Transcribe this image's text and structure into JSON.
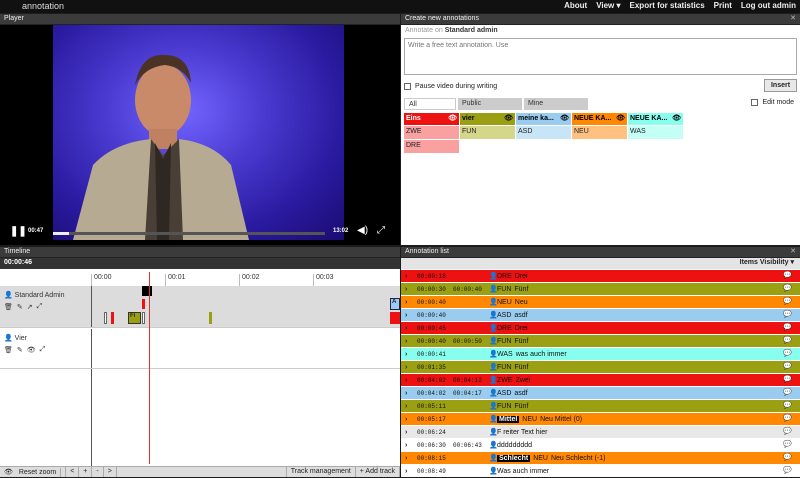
{
  "topbar": {
    "brand": "annotation",
    "menu": [
      "About",
      "View ▾",
      "Export for statistics",
      "Print",
      "Log out admin"
    ]
  },
  "player": {
    "header": "Player",
    "current_time": "00:47",
    "duration": "13:02",
    "progress": 0.06
  },
  "create": {
    "header": "Create new annotations",
    "annotate_on_label": "Annotate on",
    "annotate_on_value": "Standard admin",
    "placeholder": "Write a free text annotation. Use",
    "pause_label": "Pause video during writing",
    "insert_label": "Insert",
    "tabs": [
      "All",
      "Public",
      "Mine"
    ],
    "edit_mode_label": "Edit mode",
    "categories": [
      {
        "name": "Eins",
        "color": "#ee1111",
        "text": "#ffffff",
        "labels": [
          {
            "t": "ZWE",
            "c": "#f9a0a0"
          },
          {
            "t": "DRE",
            "c": "#f9a0a0"
          }
        ]
      },
      {
        "name": "vier",
        "color": "#9aa011",
        "text": "#000000",
        "labels": [
          {
            "t": "FUN",
            "c": "#d4d68a"
          }
        ]
      },
      {
        "name": "meine ka...",
        "color": "#99ccee",
        "text": "#000000",
        "labels": [
          {
            "t": "ASD",
            "c": "#c8e4f7"
          }
        ]
      },
      {
        "name": "NEUE KA...",
        "color": "#ff8800",
        "text": "#000000",
        "labels": [
          {
            "t": "NEU",
            "c": "#ffc080"
          }
        ]
      },
      {
        "name": "NEUE KA...",
        "color": "#88ffee",
        "text": "#000000",
        "labels": [
          {
            "t": "WAS",
            "c": "#c4fff6"
          }
        ]
      }
    ]
  },
  "timeline": {
    "header": "Timeline",
    "current": "00:00:46",
    "ticks": [
      "00:00",
      "00:01",
      "00:02",
      "00:03"
    ],
    "tracks": [
      {
        "name": "Standard Admin"
      },
      {
        "name": "Vier"
      }
    ],
    "marker_label": "Fi",
    "marker_label_a": "A",
    "footer": [
      "Reset zoom",
      "<",
      "+",
      "-",
      ">",
      "Track management",
      "+ Add track"
    ]
  },
  "alist": {
    "header": "Annotation list",
    "visibility": "Items Visibility ▾",
    "rows": [
      {
        "t1": "00:00:18",
        "t2": "",
        "code": "DRE",
        "text": "Drei",
        "bg": "#ee1111",
        "fg": "#111"
      },
      {
        "t1": "00:00:30",
        "t2": "00:00:40",
        "code": "FUN",
        "text": "Fünf",
        "bg": "#9aa011",
        "fg": "#111"
      },
      {
        "t1": "00:00:40",
        "t2": "",
        "code": "NEU",
        "text": "Neu",
        "bg": "#ff8800",
        "fg": "#111"
      },
      {
        "t1": "00:00:40",
        "t2": "",
        "code": "ASD",
        "text": "asdf",
        "bg": "#99ccee",
        "fg": "#111"
      },
      {
        "t1": "00:00:45",
        "t2": "",
        "code": "DRE",
        "text": "Drei",
        "bg": "#ee1111",
        "fg": "#111"
      },
      {
        "t1": "00:00:40",
        "t2": "00:00:50",
        "code": "FUN",
        "text": "Fünf",
        "bg": "#9aa011",
        "fg": "#111"
      },
      {
        "t1": "00:00:41",
        "t2": "",
        "code": "WAS",
        "text": "was auch immer",
        "bg": "#88ffee",
        "fg": "#111"
      },
      {
        "t1": "00:01:35",
        "t2": "",
        "code": "FUN",
        "text": "Fünf",
        "bg": "#9aa011",
        "fg": "#111"
      },
      {
        "t1": "00:04:02",
        "t2": "00:04:12",
        "code": "ZWE",
        "text": "Zwei",
        "bg": "#ee1111",
        "fg": "#111"
      },
      {
        "t1": "00:04:02",
        "t2": "00:04:17",
        "code": "ASD",
        "text": "asdf",
        "bg": "#99ccee",
        "fg": "#111"
      },
      {
        "t1": "00:05:11",
        "t2": "",
        "code": "FUN",
        "text": "Fünf",
        "bg": "#9aa011",
        "fg": "#111"
      },
      {
        "t1": "00:05:17",
        "t2": "",
        "tag": "Mittel",
        "code": "NEU",
        "text": "Neu Mittel (0)",
        "bg": "#ff8800",
        "fg": "#111"
      },
      {
        "t1": "00:06:24",
        "t2": "",
        "code": "",
        "text": "F reiter Text hier",
        "bg": "#e8e8e8",
        "fg": "#111"
      },
      {
        "t1": "00:06:30",
        "t2": "00:06:43",
        "code": "",
        "text": "ddddddddd",
        "bg": "#ffffff",
        "fg": "#111"
      },
      {
        "t1": "00:08:15",
        "t2": "",
        "tag": "Schlecht",
        "code": "NEU",
        "text": "Neu Schlecht (-1)",
        "bg": "#ff8800",
        "fg": "#111"
      },
      {
        "t1": "00:08:49",
        "t2": "",
        "code": "",
        "text": "Was auch immer",
        "bg": "#ffffff",
        "fg": "#111"
      }
    ]
  }
}
